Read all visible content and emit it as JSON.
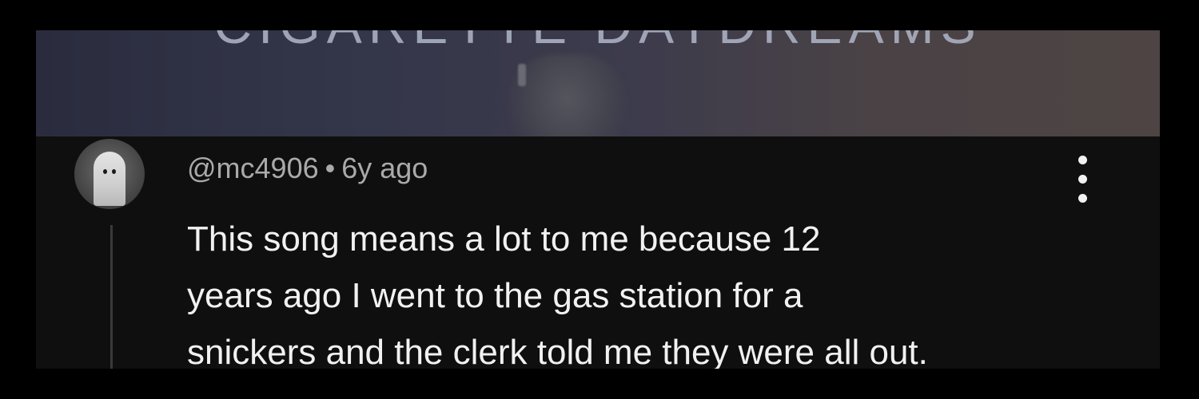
{
  "video": {
    "title_overlay": "CIGARETTE DAYDREAMS"
  },
  "comment": {
    "author": "@mc4906",
    "separator": "•",
    "timestamp": "6y ago",
    "text_lines": [
      "This song means a lot to me because 12",
      "years ago I went to the gas station for a",
      "snickers and the clerk told me they were all out."
    ],
    "avatar_icon": "ghost-icon",
    "menu_icon": "more-vertical-icon"
  },
  "colors": {
    "background": "#000000",
    "comment_background": "#0f0f0f",
    "text_primary": "#f1f1f1",
    "text_secondary": "#aaaaaa",
    "thread_line": "#3a3a3a"
  }
}
